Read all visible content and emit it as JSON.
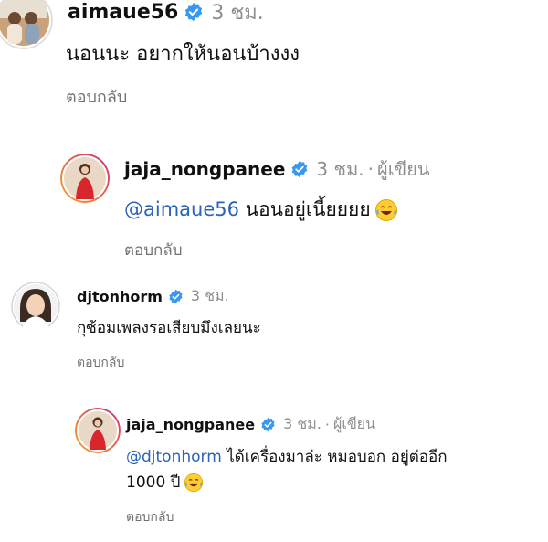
{
  "comments": [
    {
      "username": "aimaue56",
      "time": "3 ชม.",
      "text": "นอนนะ อยากให้นอนบ้างงง",
      "reply_label": "ตอบกลับ",
      "avatar_icon": "profile-photo-icon"
    },
    {
      "username": "jaja_nongpanee",
      "time": "3 ชม.",
      "separator": "·",
      "author_label": "ผู้เขียน",
      "mention": "@aimaue56",
      "text": "นอนอยู่เนี้ยยยย",
      "emoji": "laughing-tears-emoji",
      "reply_label": "ตอบกลับ",
      "avatar_icon": "profile-photo-icon"
    },
    {
      "username": "djtonhorm",
      "time": "3 ชม.",
      "text": "กุซ้อมเพลงรอเสียบมึงเลยนะ",
      "reply_label": "ตอบกลับ",
      "avatar_icon": "profile-photo-icon"
    },
    {
      "username": "jaja_nongpanee",
      "time": "3 ชม.",
      "separator": "·",
      "author_label": "ผู้เขียน",
      "mention": "@djtonhorm",
      "text_line1": "ได้เครื่องมาล่ะ หมอบอก อยู่ต่ออีก",
      "text_line2": "1000 ปี",
      "emoji": "laughing-tears-emoji",
      "reply_label": "ตอบกลับ",
      "avatar_icon": "profile-photo-icon"
    }
  ],
  "colors": {
    "verified_badge": "#3897f0",
    "mention": "#2a63b8",
    "meta_gray": "#8e8e8e",
    "story_ring_orange": "#f5a623",
    "story_ring_pink": "#d62976"
  }
}
